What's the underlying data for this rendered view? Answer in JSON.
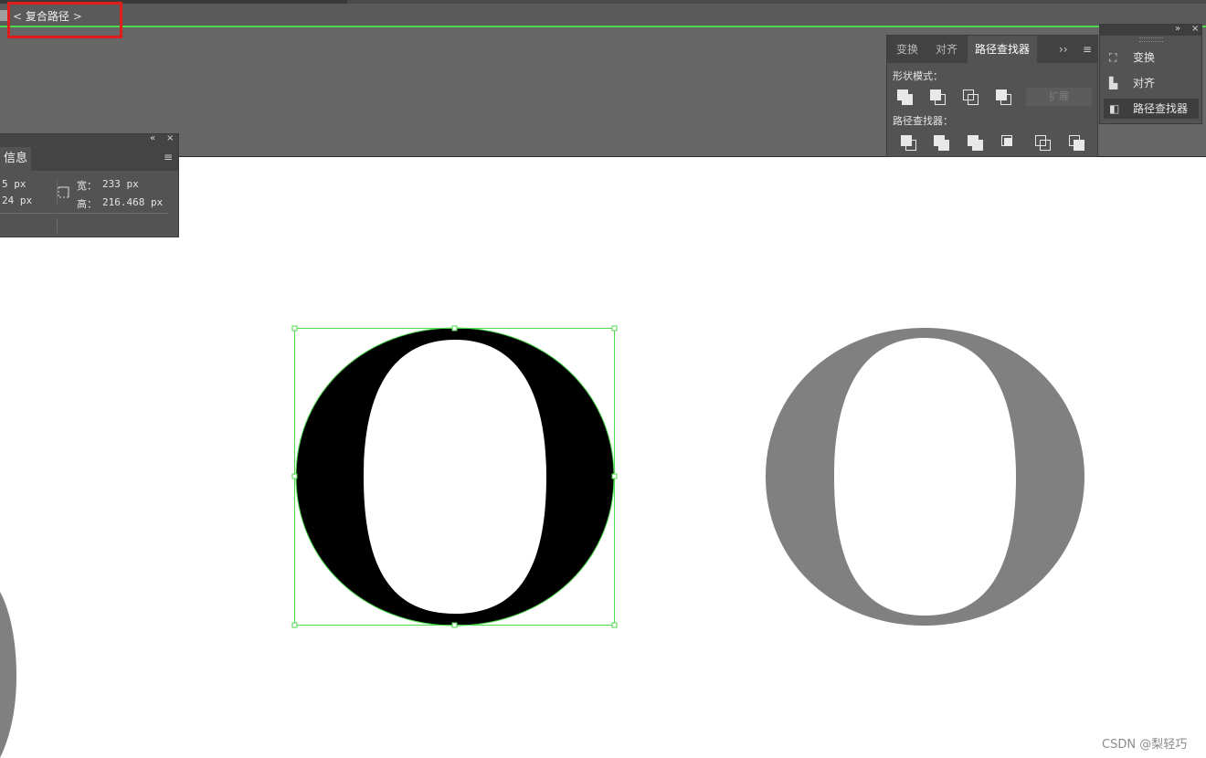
{
  "breadcrumb": {
    "back": "<",
    "title": "复合路径",
    "forward": ">"
  },
  "pathfinder_panel": {
    "tabs": [
      {
        "label": "变换",
        "active": false
      },
      {
        "label": "对齐",
        "active": false
      },
      {
        "label": "路径查找器",
        "active": true
      }
    ],
    "more_icon": "››",
    "menu_icon": "≡",
    "shape_modes_label": "形状模式：",
    "expand_label": "扩展",
    "pathfinders_label": "路径查找器："
  },
  "dock": {
    "collapse_icon": "»",
    "close_icon": "×",
    "items": [
      {
        "label": "变换",
        "icon": "transform-icon",
        "active": false
      },
      {
        "label": "对齐",
        "icon": "align-icon",
        "active": false
      },
      {
        "label": "路径查找器",
        "icon": "pathfinder-icon",
        "active": true
      }
    ]
  },
  "info_panel": {
    "collapse_icon": "«",
    "close_icon": "×",
    "tab_label": "信息",
    "menu_icon": "≡",
    "x_value": "5 px",
    "y_value": "24 px",
    "width_label": "宽：",
    "width_value": "233 px",
    "height_label": "高：",
    "height_value": "216.468 px"
  },
  "canvas": {
    "selection_color": "#4cd94c",
    "selected_fill": "#000000",
    "other_fill": "#808080",
    "highlight_color": "#e21b1b"
  },
  "watermark": "CSDN @梨轻巧"
}
